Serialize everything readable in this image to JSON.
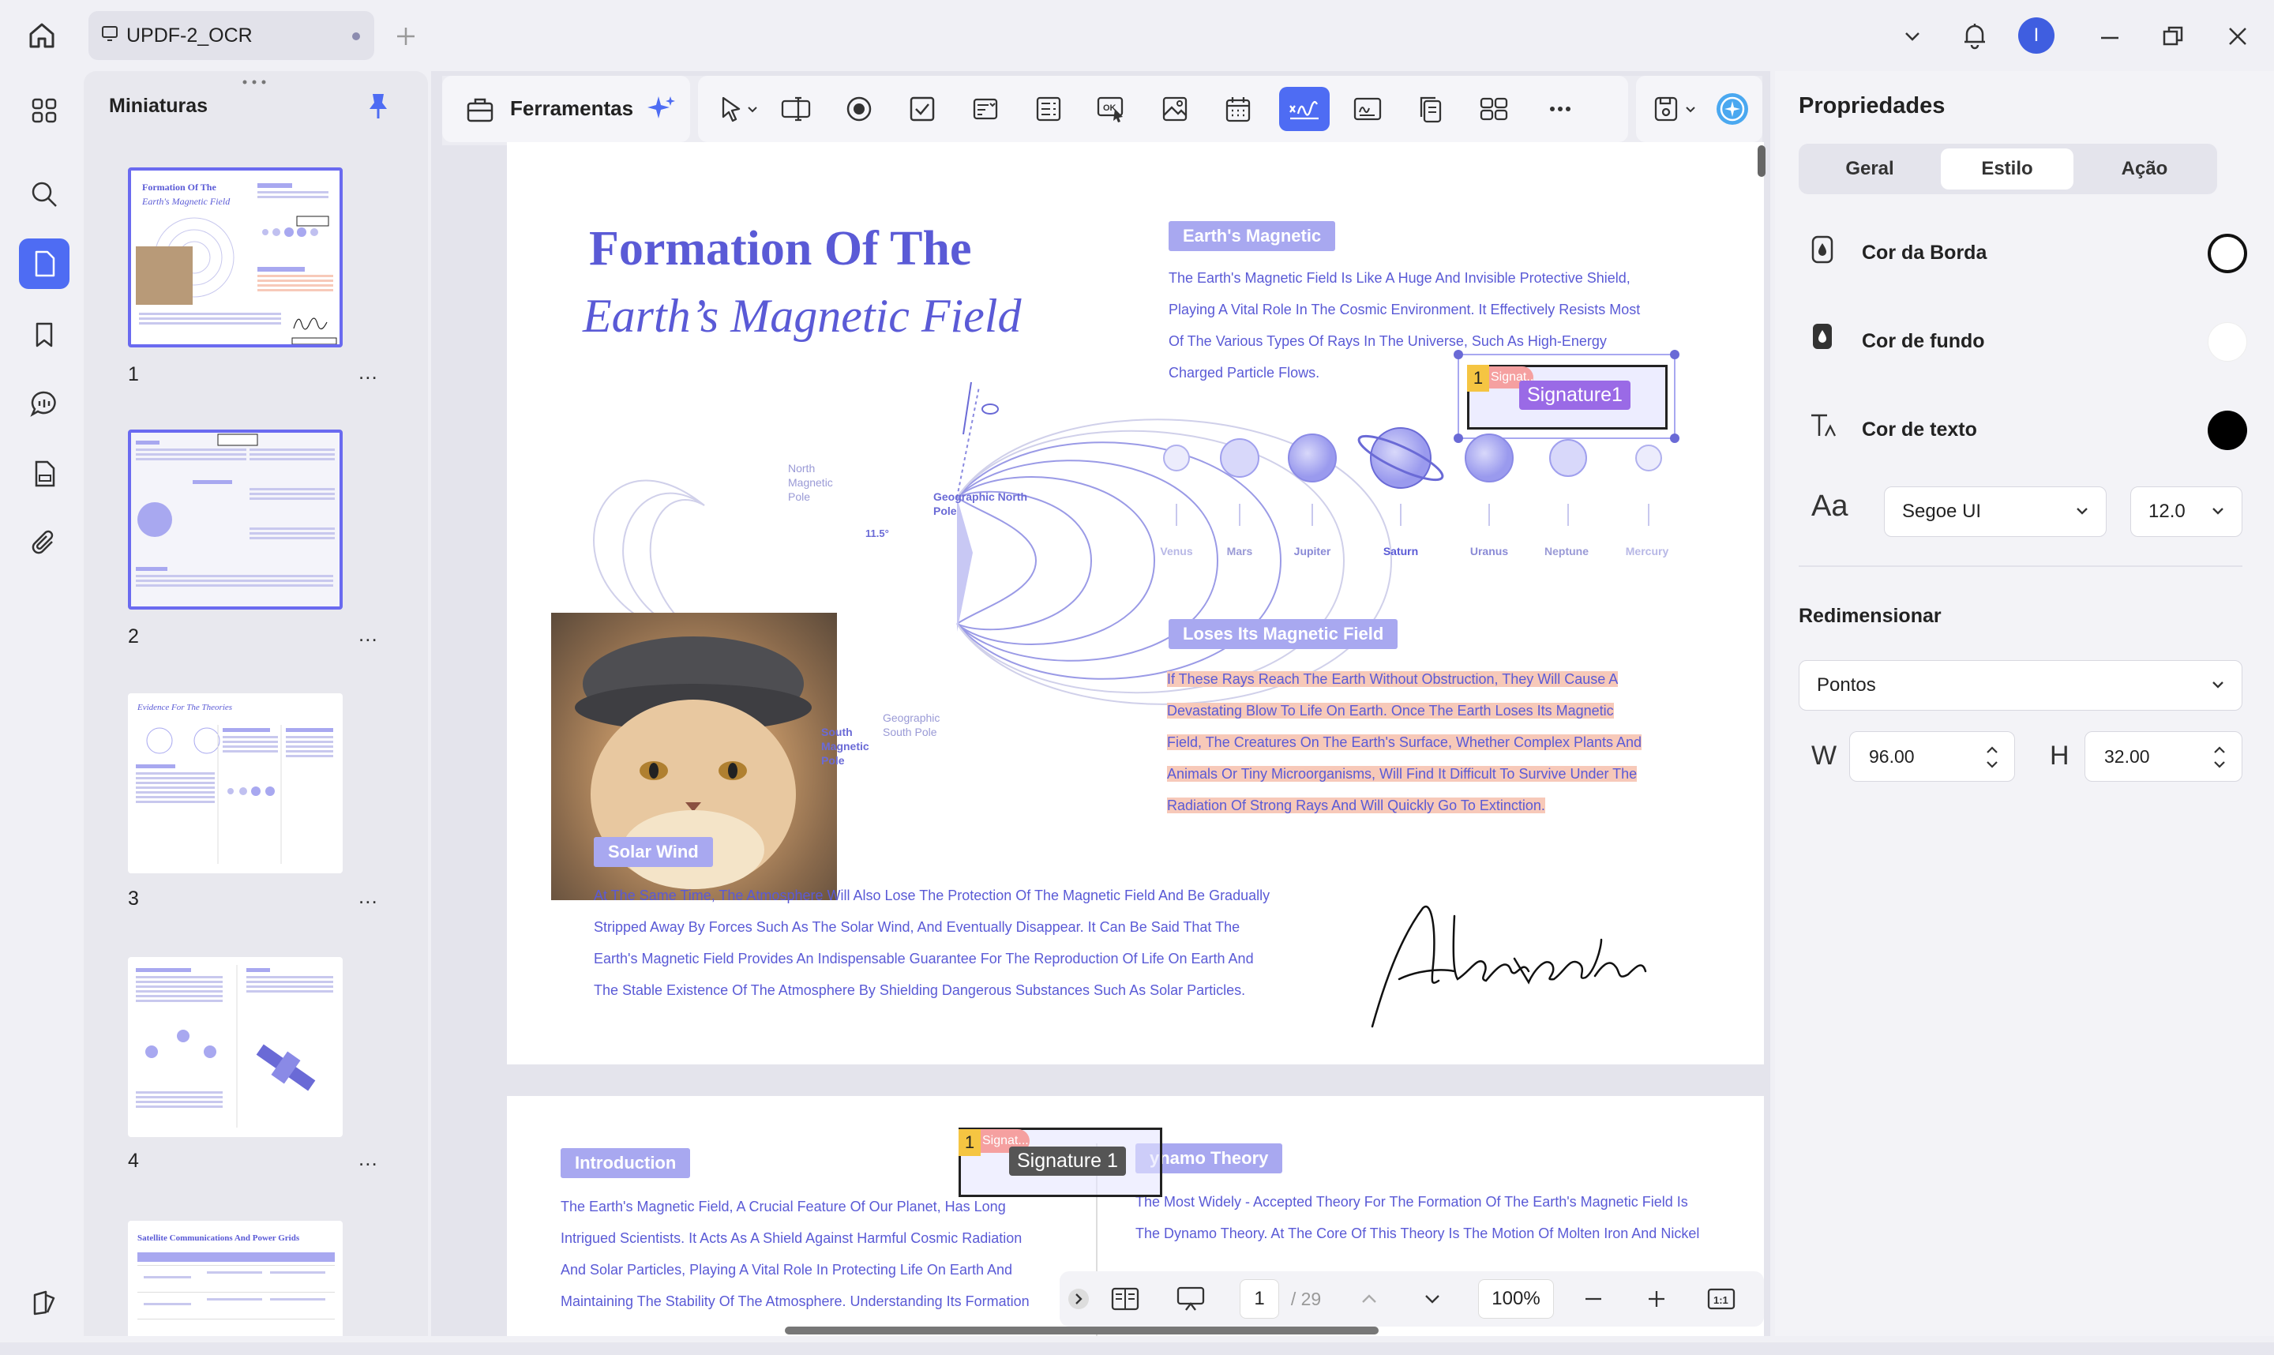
{
  "window": {
    "tab_title": "UPDF-2_OCR",
    "avatar_initial": "I"
  },
  "thumbnails": {
    "title": "Miniaturas",
    "items": [
      {
        "number": "1",
        "more": "...",
        "title_line1": "Formation Of The",
        "title_line2": "Earth's Magnetic Field"
      },
      {
        "number": "2",
        "more": "..."
      },
      {
        "number": "3",
        "more": "...",
        "title": "Evidence For The Theories"
      },
      {
        "number": "4",
        "more": "..."
      },
      {
        "number": "",
        "more": "",
        "title": "Satellite Communications And Power Grids"
      }
    ]
  },
  "toolbar": {
    "tools_label": "Ferramentas"
  },
  "page1": {
    "title_line1": "Formation Of The",
    "title_line2": "Earth’s Magnetic Field",
    "north_magnetic_pole": "North Magnetic Pole",
    "geographic_north_pole": "Geographic North Pole",
    "angle_label": "11.5°",
    "geographic_south_pole": "Geographic South Pole",
    "south_magnetic_pole": "South Magnetic Pole",
    "earths_magnetic_heading": "Earth's Magnetic",
    "earths_magnetic_text": [
      "The Earth's Magnetic Field Is Like A Huge And Invisible Protective Shield,",
      "Playing A Vital Role In The Cosmic Environment. It Effectively Resists Most",
      "Of The Various Types Of Rays In The Universe, Such As High-Energy",
      "Charged Particle Flows."
    ],
    "planets": [
      "Venus",
      "Mars",
      "Jupiter",
      "Saturn",
      "Uranus",
      "Neptune",
      "Mercury"
    ],
    "loses_heading": "Loses Its Magnetic Field",
    "loses_text": [
      "If These Rays Reach The Earth Without Obstruction, They Will Cause A",
      "Devastating Blow To Life On Earth. Once The Earth Loses Its Magnetic",
      "Field, The Creatures On The Earth's Surface, Whether Complex Plants And",
      "Animals Or Tiny Microorganisms, Will Find It Difficult To Survive Under The",
      "Radiation Of Strong Rays And Will Quickly Go To Extinction."
    ],
    "solar_wind_heading": "Solar Wind",
    "solar_wind_text": [
      "At The Same Time, The Atmosphere Will Also Lose The Protection Of The Magnetic Field And Be Gradually",
      "Stripped Away By Forces Such As The Solar Wind, And Eventually Disappear. It Can Be Said That The",
      "Earth's Magnetic Field Provides An Indispensable Guarantee For The Reproduction Of Life On Earth And",
      "The Stable Existence Of The Atmosphere By Shielding Dangerous Substances Such As Solar Particles."
    ],
    "signature_name": "Alexandra",
    "signature_field_tag": "1",
    "signature_field_label": "Signature1",
    "signature_field_ghost": "Signat..."
  },
  "page2": {
    "intro_heading": "Introduction",
    "intro_text": [
      "The Earth's Magnetic Field, A Crucial Feature Of Our Planet, Has Long",
      "Intrigued Scientists. It Acts As A Shield Against Harmful Cosmic Radiation",
      "And Solar Particles, Playing A Vital Role In Protecting Life On Earth And",
      "Maintaining The Stability Of The Atmosphere. Understanding Its Formation"
    ],
    "dynamo_heading": "ynamo Theory",
    "dynamo_text": [
      "The Most Widely - Accepted Theory For The Formation Of The Earth's Magnetic Field Is",
      "The Dynamo Theory. At The Core Of This Theory Is The Motion Of Molten Iron And Nickel"
    ],
    "signature_field_tag": "1",
    "signature_field_label": "Signature 1",
    "signature_field_ghost": "Signat..."
  },
  "navigation": {
    "current_page": "1",
    "total_pages": "/ 29",
    "zoom": "100%"
  },
  "properties": {
    "title": "Propriedades",
    "tabs": [
      "Geral",
      "Estilo",
      "Ação"
    ],
    "active_tab": "Estilo",
    "border_color_label": "Cor da Borda",
    "background_color_label": "Cor de fundo",
    "text_color_label": "Cor de texto",
    "font_icon": "Aa",
    "font_name": "Segoe UI",
    "font_size": "12.0",
    "resize_title": "Redimensionar",
    "unit": "Pontos",
    "w_label": "W",
    "w_value": "96.00",
    "h_label": "H",
    "h_value": "32.00",
    "colors": {
      "border": "#ffffff",
      "background": "#ffffff",
      "text": "#000000"
    }
  },
  "colors": {
    "accent": "#4e6cf3",
    "purple_text": "#5a5ad6",
    "section_bg": "#a8a8f0",
    "highlight": "#f7c9b9"
  }
}
